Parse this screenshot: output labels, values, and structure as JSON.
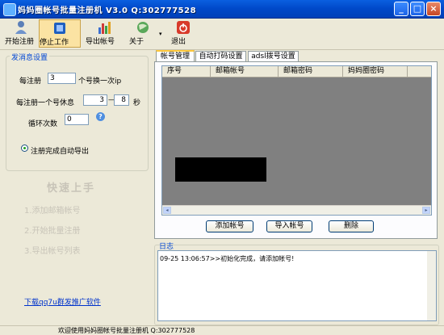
{
  "window": {
    "title": "妈妈圈帐号批量注册机 V3.0  Q:302777528",
    "minimize_label": "_",
    "maximize_label": "□",
    "close_label": "×"
  },
  "toolbar": {
    "start": "开始注册",
    "stop": "停止工作",
    "export": "导出帐号",
    "about": "关于",
    "exit": "退出",
    "about_chevron": "▾"
  },
  "settings": {
    "title": "发消息设置",
    "per_register_label": "每注册",
    "per_register_value": "3",
    "per_register_suffix": "个号换一次ip",
    "rest_label": "每注册一个号休息",
    "rest_min": "3",
    "rest_dash": "—",
    "rest_max": "8",
    "rest_unit": "秒",
    "loop_label": "循环次数",
    "loop_value": "0",
    "help_icon_text": "?",
    "auto_export_label": "注册完成自动导出"
  },
  "quickstart": {
    "title": "快速上手",
    "step1": "1.添加邮箱帐号",
    "step2": "2.开始批量注册",
    "step3": "3.导出帐号列表"
  },
  "download_link": "下载qq7u群发推广软件",
  "tabs": {
    "account": "帐号管理",
    "captcha": "自动打码设置",
    "adsl": "adsl拨号设置"
  },
  "grid": {
    "columns": [
      "序号",
      "邮箱帐号",
      "邮箱密码",
      "妈妈圈密码"
    ],
    "scroll_left": "◂",
    "scroll_right": "▸"
  },
  "buttons": {
    "add": "添加帐号",
    "import": "导入帐号",
    "delete": "删除"
  },
  "log": {
    "title": "日志",
    "lines": [
      "09-25 13:06:57>>初始化完成，请添加帐号!"
    ]
  },
  "status": {
    "text": "欢迎使用妈妈圈帐号批量注册机 Q:302777528"
  },
  "colors": {
    "title_bar": "#0048c8",
    "group_title": "#0046d5",
    "link": "#0033cc",
    "grid_bg": "#808080"
  }
}
